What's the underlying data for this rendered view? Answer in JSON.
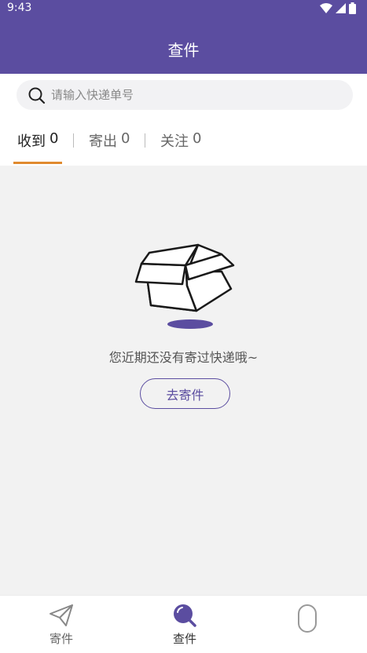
{
  "status_bar": {
    "time": "9:43"
  },
  "header": {
    "title": "查件"
  },
  "search": {
    "placeholder": "请输入快递单号"
  },
  "tabs": [
    {
      "label": "收到",
      "count": "0"
    },
    {
      "label": "寄出",
      "count": "0"
    },
    {
      "label": "关注",
      "count": "0"
    }
  ],
  "empty_state": {
    "message": "您近期还没有寄过快递哦~",
    "button_label": "去寄件"
  },
  "bottom_nav": [
    {
      "label": "寄件",
      "icon": "paper-plane-icon"
    },
    {
      "label": "查件",
      "icon": "search-icon"
    },
    {
      "label": "",
      "icon": "mouse-icon"
    }
  ],
  "colors": {
    "brand": "#5b4da0",
    "tab_indicator": "#e08a2e"
  }
}
